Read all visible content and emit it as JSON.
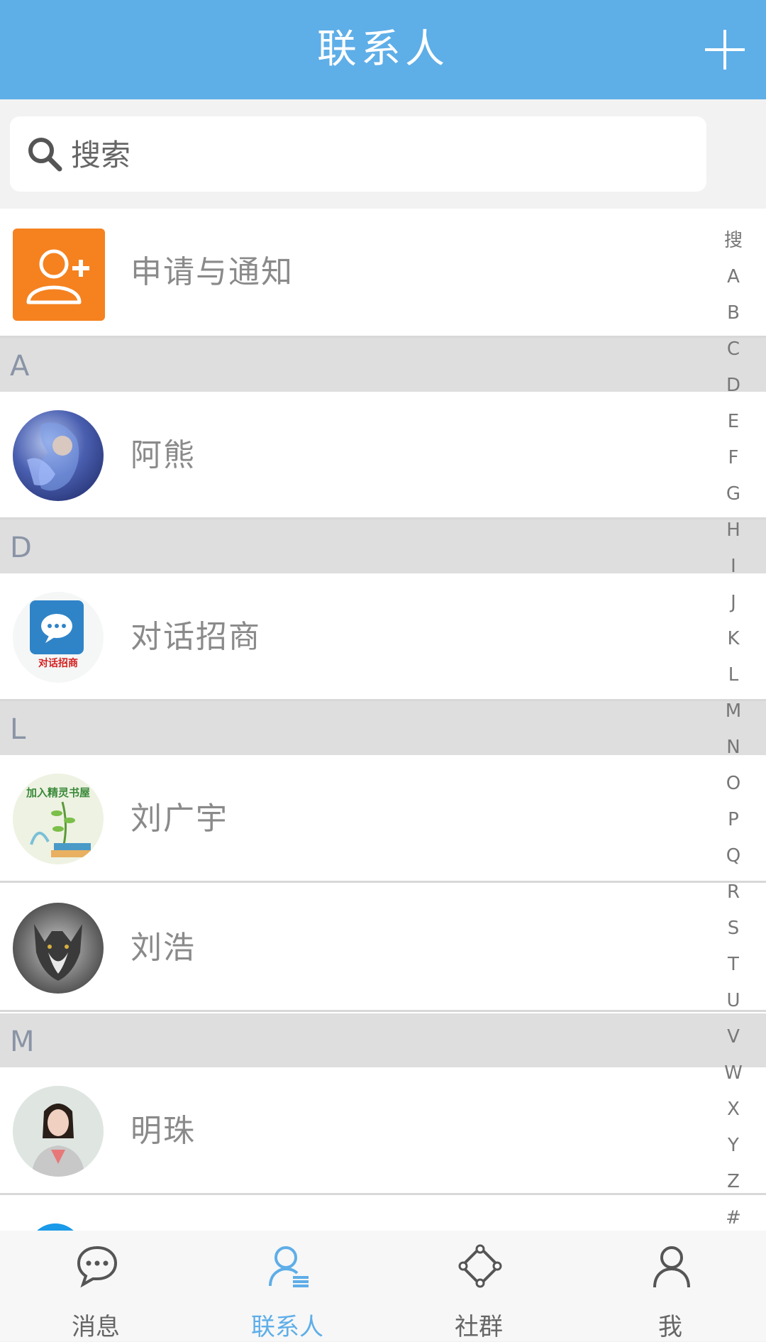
{
  "header": {
    "title": "联系人",
    "add_icon": "plus-icon"
  },
  "search": {
    "placeholder": "搜索",
    "icon": "search-icon"
  },
  "notify": {
    "label": "申请与通知",
    "icon": "add-user-icon",
    "color": "#f5821f"
  },
  "sections": [
    {
      "letter": "A",
      "contacts": [
        {
          "name": "阿熊"
        }
      ]
    },
    {
      "letter": "D",
      "contacts": [
        {
          "name": "对话招商",
          "badge_text": "对话招商"
        }
      ]
    },
    {
      "letter": "L",
      "contacts": [
        {
          "name": "刘广宇",
          "badge_text": "加入精灵书屋"
        },
        {
          "name": "刘浩"
        }
      ]
    },
    {
      "letter": "M",
      "contacts": [
        {
          "name": "明珠"
        }
      ]
    }
  ],
  "index_bar": [
    "搜",
    "A",
    "B",
    "C",
    "D",
    "E",
    "F",
    "G",
    "H",
    "I",
    "J",
    "K",
    "L",
    "M",
    "N",
    "O",
    "P",
    "Q",
    "R",
    "S",
    "T",
    "U",
    "V",
    "W",
    "X",
    "Y",
    "Z",
    "#"
  ],
  "tabs": [
    {
      "label": "消息",
      "icon": "chat-bubble-icon",
      "active": false
    },
    {
      "label": "联系人",
      "icon": "contacts-icon",
      "active": true
    },
    {
      "label": "社群",
      "icon": "community-icon",
      "active": false
    },
    {
      "label": "我",
      "icon": "person-icon",
      "active": false
    }
  ],
  "colors": {
    "header": "#5eaee8",
    "accent": "#5eaee8",
    "section_bg": "#dedede"
  }
}
